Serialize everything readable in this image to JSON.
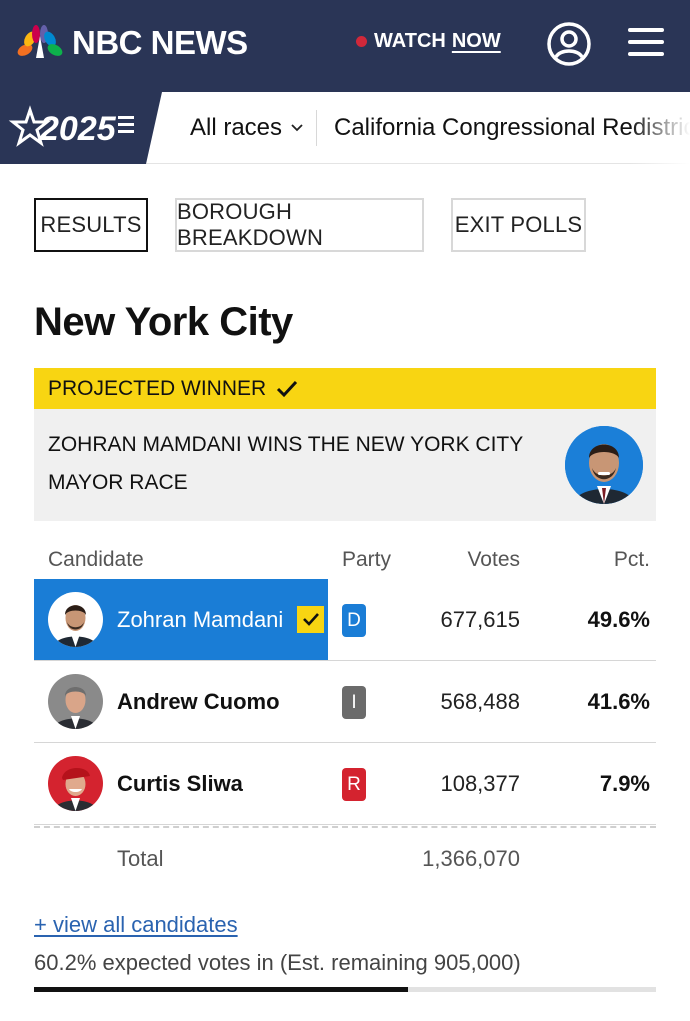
{
  "header": {
    "brand": "NBC NEWS",
    "watch_label": "WATCH",
    "watch_now_label": "NOW",
    "colors": {
      "bg": "#2a3556",
      "live_dot": "#d0283a"
    }
  },
  "election_nav": {
    "year_badge": "2025",
    "all_races_label": "All races",
    "race_link": "California Congressional Redistricting"
  },
  "tabs": [
    {
      "label": "RESULTS",
      "active": true
    },
    {
      "label": "BOROUGH BREAKDOWN",
      "active": false
    },
    {
      "label": "EXIT POLLS",
      "active": false
    }
  ],
  "race": {
    "title": "New York City",
    "banner_label": "PROJECTED WINNER",
    "winner_text": "ZOHRAN MAMDANI WINS THE NEW YORK CITY MAYOR RACE"
  },
  "table": {
    "headers": {
      "candidate": "Candidate",
      "party": "Party",
      "votes": "Votes",
      "pct": "Pct."
    },
    "rows": [
      {
        "name": "Zohran Mamdani",
        "party": "D",
        "party_color": "#1a7dd6",
        "votes": "677,615",
        "pct": "49.6%",
        "winner": true
      },
      {
        "name": "Andrew Cuomo",
        "party": "I",
        "party_color": "#6b6b6b",
        "votes": "568,488",
        "pct": "41.6%",
        "winner": false
      },
      {
        "name": "Curtis Sliwa",
        "party": "R",
        "party_color": "#d4232f",
        "votes": "108,377",
        "pct": "7.9%",
        "winner": false
      }
    ],
    "total_label": "Total",
    "total_votes": "1,366,070"
  },
  "footer": {
    "view_all": "+ view all candidates",
    "expected": "60.2% expected votes in (Est. remaining 905,000)",
    "progress_fraction": 0.602
  },
  "colors": {
    "accent_blue": "#1a7dd6",
    "highlight_yellow": "#f8d512"
  }
}
